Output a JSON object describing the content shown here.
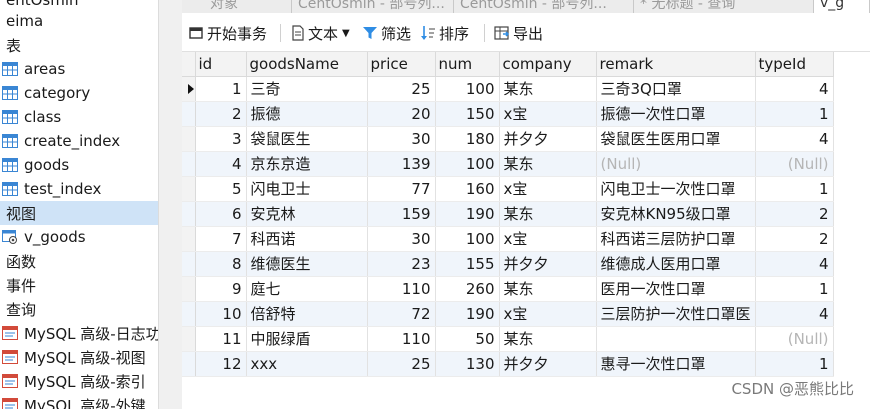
{
  "sidebar": {
    "items": [
      {
        "label": "entOsmin",
        "icon": "none"
      },
      {
        "label": "eima",
        "icon": "none"
      },
      {
        "label": "表",
        "icon": "none"
      },
      {
        "label": "areas",
        "icon": "table-icon"
      },
      {
        "label": "category",
        "icon": "table-icon"
      },
      {
        "label": "class",
        "icon": "table-icon"
      },
      {
        "label": "create_index",
        "icon": "table-icon"
      },
      {
        "label": "goods",
        "icon": "table-icon"
      },
      {
        "label": "test_index",
        "icon": "table-icon"
      },
      {
        "label": "视图",
        "icon": "none",
        "selected": true
      },
      {
        "label": "v_goods",
        "icon": "view-icon"
      },
      {
        "label": "函数",
        "icon": "none"
      },
      {
        "label": "事件",
        "icon": "none"
      },
      {
        "label": "查询",
        "icon": "none"
      },
      {
        "label": "MySQL 高级-日志功",
        "icon": "query-icon"
      },
      {
        "label": "MySQL 高级-视图",
        "icon": "query-icon"
      },
      {
        "label": "MySQL 高级-索引",
        "icon": "query-icon"
      },
      {
        "label": "MySQL 高级-外键",
        "icon": "query-icon"
      }
    ]
  },
  "tabs": [
    {
      "label": "对象"
    },
    {
      "label": "CentOsmin - 部号列..."
    },
    {
      "label": "CentOsmin - 部号列..."
    },
    {
      "label": "* 无标题 - 查询"
    },
    {
      "label": "v_g"
    }
  ],
  "toolbar": {
    "begin_transaction": "开始事务",
    "text": "文本",
    "filter": "筛选",
    "sort": "排序",
    "export": "导出"
  },
  "grid": {
    "columns": [
      "id",
      "goodsName",
      "price",
      "num",
      "company",
      "remark",
      "typeId"
    ],
    "rows": [
      [
        "1",
        "三奇",
        "25",
        "100",
        "某东",
        "三奇3Q口罩",
        "4"
      ],
      [
        "2",
        "振德",
        "20",
        "150",
        "x宝",
        "振德一次性口罩",
        "1"
      ],
      [
        "3",
        "袋鼠医生",
        "30",
        "180",
        "并夕夕",
        "袋鼠医生医用口罩",
        "4"
      ],
      [
        "4",
        "京东京造",
        "139",
        "100",
        "某东",
        "(Null)",
        "(Null)"
      ],
      [
        "5",
        "闪电卫士",
        "77",
        "160",
        "x宝",
        "闪电卫士一次性口罩",
        "1"
      ],
      [
        "6",
        "安克林",
        "159",
        "190",
        "某东",
        "安克林KN95级口罩",
        "2"
      ],
      [
        "7",
        "科西诺",
        "30",
        "100",
        "x宝",
        "科西诺三层防护口罩",
        "2"
      ],
      [
        "8",
        "维德医生",
        "23",
        "155",
        "并夕夕",
        "维德成人医用口罩",
        "4"
      ],
      [
        "9",
        "庭七",
        "110",
        "260",
        "某东",
        "医用一次性口罩",
        "1"
      ],
      [
        "10",
        "倍舒特",
        "72",
        "190",
        "x宝",
        "三层防护一次性口罩医",
        "4"
      ],
      [
        "11",
        "中服绿盾",
        "110",
        "50",
        "某东",
        "",
        "(Null)"
      ],
      [
        "12",
        "xxx",
        "25",
        "130",
        "并夕夕",
        "惠寻一次性口罩",
        "1"
      ]
    ]
  },
  "watermark": "CSDN @恶熊比比",
  "colors": {
    "selection": "#cfe3f7",
    "alt_row": "#f0f5fb",
    "null_text": "#b5b5b5"
  }
}
